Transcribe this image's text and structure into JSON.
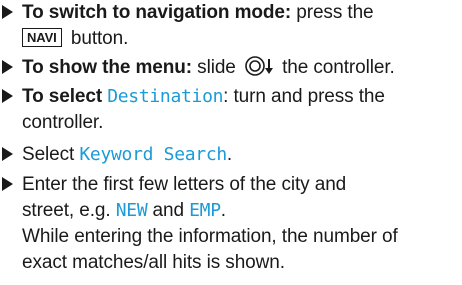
{
  "steps": [
    {
      "lead": "To switch to navigation mode:",
      "text1": " press the",
      "key": "NAVI",
      "text2": " button."
    },
    {
      "lead": "To show the menu:",
      "text1": " slide ",
      "text2": " the controller.",
      "icon": "controller-slide-down-icon"
    },
    {
      "lead": "To select ",
      "display": "Destination",
      "text1": ": turn and press the",
      "text2": "controller."
    },
    {
      "text1": "Select ",
      "display": "Keyword Search",
      "text2": "."
    },
    {
      "text1": "Enter the first few letters of the city and",
      "text2": "street, e.g. ",
      "display1": "NEW",
      "and": " and ",
      "display2": "EMP",
      "end": ".",
      "note1": "While entering the information, the number of",
      "note2": "exact matches/all hits is shown."
    }
  ],
  "colors": {
    "display_text": "#1b9bd7",
    "text": "#1a1a1a"
  }
}
